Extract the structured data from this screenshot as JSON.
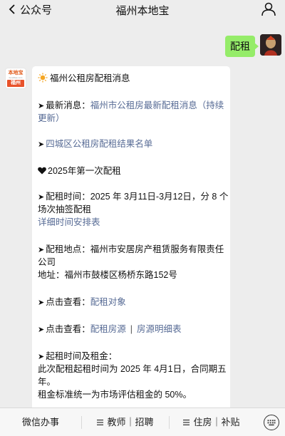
{
  "header": {
    "back_label": "公众号",
    "title": "福州本地宝"
  },
  "user_message": {
    "text": "配租"
  },
  "bot": {
    "logo_top": "本地宝",
    "logo_mid": "bendibao.com",
    "logo_city": "福州"
  },
  "message": {
    "title": "福州公租房配租消息",
    "latest_prefix": "最新消息：",
    "latest_link_1": "福州市公租房最新配租消息（持续",
    "latest_link_2": "更新）",
    "list_link": "四城区公租房配租结果名单",
    "round_title": "2025年第一次配租",
    "time_prefix": "配租时间：",
    "time_text_1": "2025 年 3月11日-3月12日，分 8 个",
    "time_text_2": "场次抽签配租",
    "time_link": "详细时间安排表",
    "place_prefix": "配租地点：",
    "place_text_1": "福州市安居房产租赁服务有限责任",
    "place_text_2": "公司",
    "address": "地址：福州市鼓楼区杨桥东路152号",
    "check_prefix": "点击查看：",
    "check_link_1": "配租对象",
    "check_link_2": "配租房源",
    "check_separator": "|",
    "check_link_3": "房源明细表",
    "start_title": "起租时间及租金：",
    "start_text_1": "此次配租起租时间为 2025 年 4月1日，合同期五",
    "start_text_2": "年。",
    "rent_text": "租金标准统一为市场评估租金的 50%。"
  },
  "menu": {
    "item_1": "微信办事",
    "item_2": "教师｜招聘",
    "item_3": "住房｜补贴"
  },
  "colors": {
    "link": "#576b95",
    "user_bubble": "#95ec69",
    "background": "#ededed",
    "brand": "#e8522a"
  },
  "icons": [
    "chevron-left-icon",
    "person-icon",
    "sun-icon",
    "heart-icon",
    "arrow-icon",
    "menu-icon",
    "keyboard-icon"
  ]
}
